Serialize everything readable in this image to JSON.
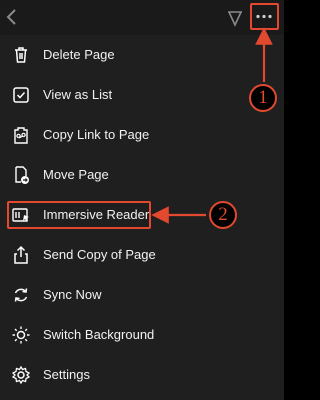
{
  "toolbar": {
    "back_icon": "chevron-left-icon",
    "pen_icon": "pen-tip-icon",
    "more_icon": "more-dots-icon"
  },
  "menu": {
    "items": [
      {
        "label": "Delete Page",
        "icon": "trash-icon"
      },
      {
        "label": "View as List",
        "icon": "checkbox-icon"
      },
      {
        "label": "Copy Link to Page",
        "icon": "link-page-icon"
      },
      {
        "label": "Move Page",
        "icon": "move-page-icon"
      },
      {
        "label": "Immersive Reader",
        "icon": "immersive-reader-icon"
      },
      {
        "label": "Send Copy of Page",
        "icon": "share-icon"
      },
      {
        "label": "Sync Now",
        "icon": "sync-icon"
      },
      {
        "label": "Switch Background",
        "icon": "sun-icon"
      },
      {
        "label": "Settings",
        "icon": "gear-icon"
      }
    ]
  },
  "annotations": {
    "step1": "1",
    "step2": "2",
    "color": "#e2492f"
  }
}
